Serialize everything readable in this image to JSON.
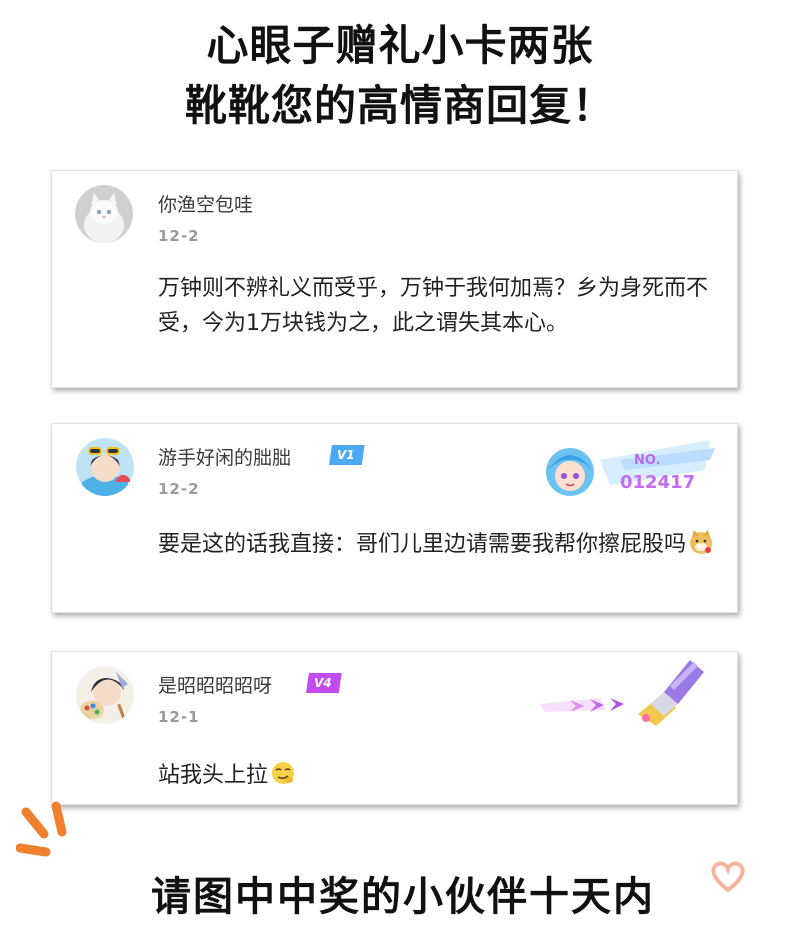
{
  "header": {
    "line1": "心眼子赠礼小卡两张",
    "line2": "靴靴您的高情商回复！"
  },
  "comments": [
    {
      "username": "你渔空包哇",
      "date": "12-2",
      "text": "万钟则不辨礼义而受乎，万钟于我何加焉？乡为身死而不受，今为1万块钱为之，此之谓失其本心。"
    },
    {
      "username": "游手好闲的朏朏",
      "badge": "V1",
      "date": "12-2",
      "decor_label1": "NO.",
      "decor_label2": "012417",
      "text": "要是这的话我直接：哥们儿里边请需要我帮你擦屁股吗"
    },
    {
      "username": "是昭昭昭昭呀",
      "badge": "V4",
      "date": "12-1",
      "text": "站我头上拉"
    }
  ],
  "footer": {
    "text": "请图中中奖的小伙伴十天内"
  },
  "colors": {
    "badge_v1": "#4ea9f5",
    "badge_v4": "#c24bf0",
    "burst": "#f08030",
    "heart": "#f5b5a0"
  }
}
